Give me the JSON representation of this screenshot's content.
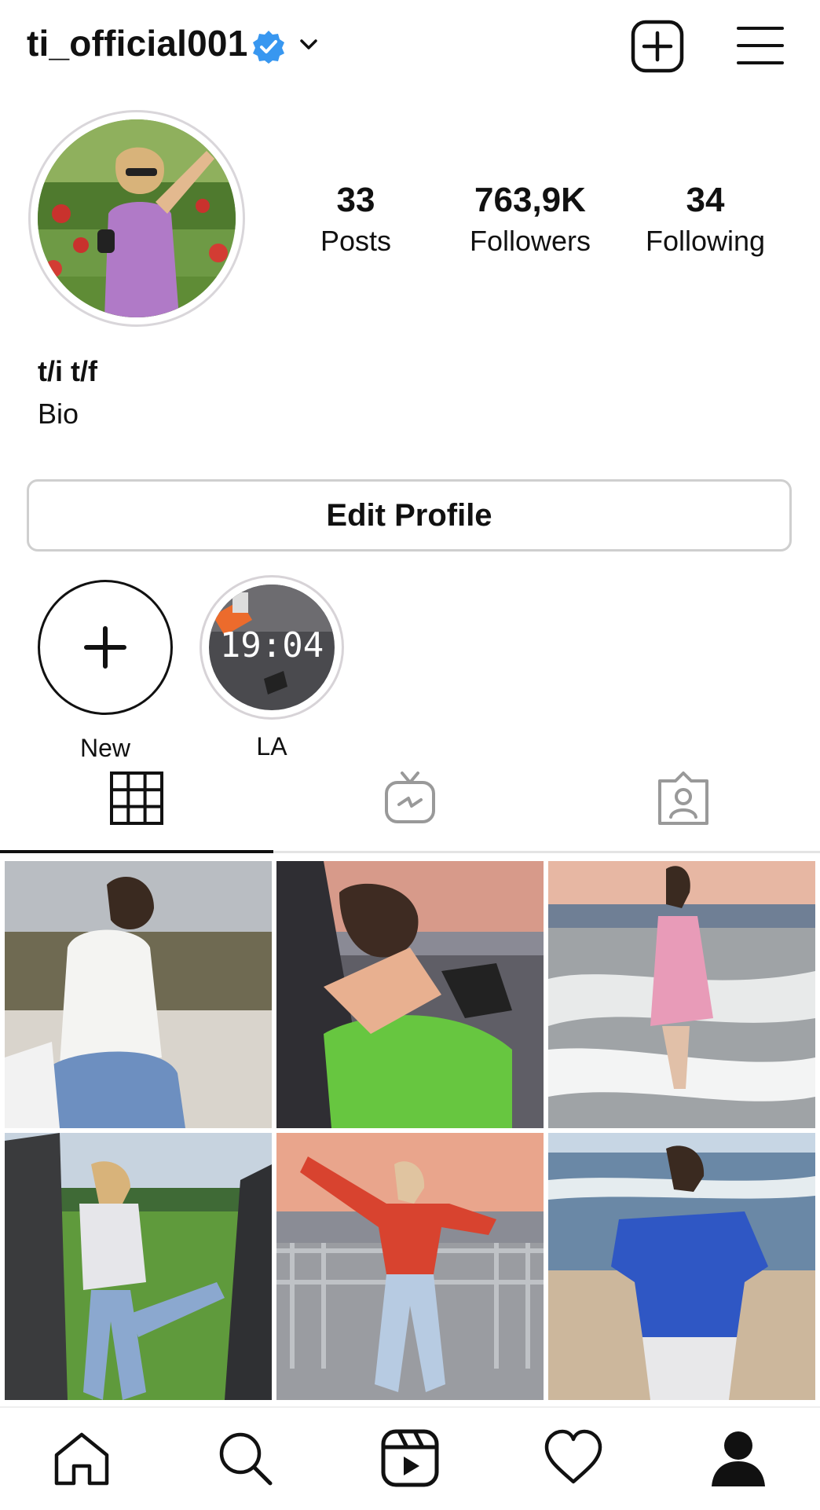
{
  "header": {
    "username": "ti_official001"
  },
  "profile": {
    "stats": [
      {
        "value": "33",
        "label": "Posts"
      },
      {
        "value": "763,9K",
        "label": "Followers"
      },
      {
        "value": "34",
        "label": "Following"
      }
    ],
    "name": "t/i t/f",
    "bio": "Bio",
    "edit_label": "Edit Profile"
  },
  "highlights": [
    {
      "label": "New"
    },
    {
      "label": "LA",
      "overlay_text": "19:04"
    }
  ],
  "tabs": [
    "grid-icon",
    "igtv-icon",
    "tagged-icon"
  ],
  "bottom_nav": [
    "home-icon",
    "search-icon",
    "reels-icon",
    "heart-icon",
    "profile-icon"
  ],
  "colors": {
    "verified": "#3897f0",
    "text": "#111111",
    "border": "#cfcfcf"
  }
}
